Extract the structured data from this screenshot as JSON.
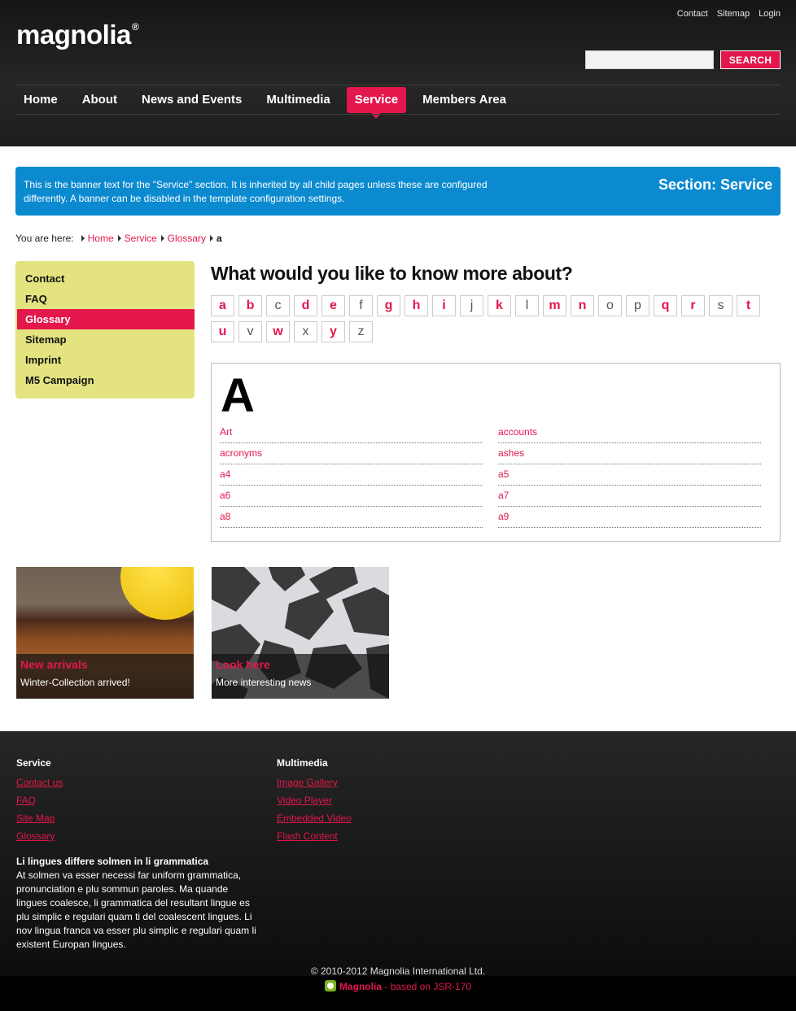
{
  "header": {
    "logo_text": "magnolia",
    "logo_mark": "®",
    "toplinks": [
      "Contact",
      "Sitemap",
      "Login"
    ],
    "search_placeholder": "",
    "search_button": "SEARCH"
  },
  "nav": {
    "items": [
      "Home",
      "About",
      "News and Events",
      "Multimedia",
      "Service",
      "Members Area"
    ],
    "active": "Service"
  },
  "banner": {
    "text": "This is the banner text for the \"Service\" section. It is inherited by all child pages unless these are configured differently. A banner can be disabled in the template configuration settings.",
    "section_label": "Section: Service"
  },
  "breadcrumb": {
    "label": "You are here:",
    "links": [
      "Home",
      "Service",
      "Glossary"
    ],
    "current": "a"
  },
  "sidebar": {
    "items": [
      "Contact",
      "FAQ",
      "Glossary",
      "Sitemap",
      "Imprint",
      "M5 Campaign"
    ],
    "active": "Glossary"
  },
  "main": {
    "title": "What would you like to know more about?",
    "letters": [
      {
        "l": "a",
        "active": true
      },
      {
        "l": "b",
        "active": true
      },
      {
        "l": "c",
        "active": false
      },
      {
        "l": "d",
        "active": true
      },
      {
        "l": "e",
        "active": true
      },
      {
        "l": "f",
        "active": false
      },
      {
        "l": "g",
        "active": true
      },
      {
        "l": "h",
        "active": true
      },
      {
        "l": "i",
        "active": true
      },
      {
        "l": "j",
        "active": false
      },
      {
        "l": "k",
        "active": true
      },
      {
        "l": "l",
        "active": false
      },
      {
        "l": "m",
        "active": true
      },
      {
        "l": "n",
        "active": true
      },
      {
        "l": "o",
        "active": false
      },
      {
        "l": "p",
        "active": false
      },
      {
        "l": "q",
        "active": true
      },
      {
        "l": "r",
        "active": true
      },
      {
        "l": "s",
        "active": false
      },
      {
        "l": "t",
        "active": true
      },
      {
        "l": "u",
        "active": true
      },
      {
        "l": "v",
        "active": false
      },
      {
        "l": "w",
        "active": true
      },
      {
        "l": "x",
        "active": false
      },
      {
        "l": "y",
        "active": true
      },
      {
        "l": "z",
        "active": false
      }
    ],
    "big_letter": "A",
    "terms": [
      "Art",
      "accounts",
      "acronyms",
      "ashes",
      "a4",
      "a5",
      "a6",
      "a7",
      "a8",
      "a9"
    ]
  },
  "teasers": [
    {
      "title": "New arrivals",
      "subtitle": "Winter-Collection arrived!"
    },
    {
      "title": "Look here",
      "subtitle": "More interesting news"
    }
  ],
  "footer": {
    "col1": {
      "heading": "Service",
      "links": [
        "Contact us",
        "FAQ",
        "Site Map",
        "Glossary"
      ]
    },
    "col2": {
      "heading": "Multimedia",
      "links": [
        "Image Gallery",
        "Video Player",
        "Embedded Video",
        "Flash Content"
      ]
    },
    "text_heading": "Li lingues differe solmen in li grammatica",
    "text_body": "At solmen va esser necessi far uniform grammatica, pronunciation e plu sommun paroles. Ma quande lingues coalesce, li grammatica del resultant lingue es plu simplic e regulari quam ti del coalescent lingues. Li nov lingua franca va esser plu simplic e regulari quam li existent Europan lingues.",
    "copyright": "© 2010-2012 Magnolia International Ltd.",
    "powered_brand": "Magnolia",
    "powered_rest": " - based on JSR-170"
  },
  "colors": {
    "accent": "#e3174b",
    "banner": "#0b8ad0",
    "sidebar": "#e3e37f"
  }
}
